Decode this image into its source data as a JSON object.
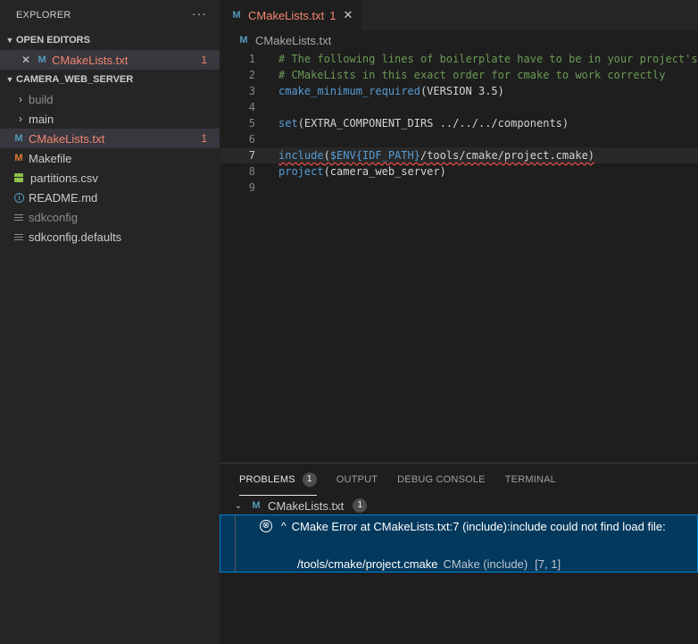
{
  "sidebar": {
    "title": "EXPLORER",
    "more": "···",
    "open_editors": {
      "label": "OPEN EDITORS",
      "items": [
        {
          "name": "CMakeLists.txt",
          "count": "1",
          "close": "✕",
          "icon_letter": "M"
        }
      ]
    },
    "project": {
      "label": "CAMERA_WEB_SERVER",
      "items": [
        {
          "name": "build",
          "kind": "folder"
        },
        {
          "name": "main",
          "kind": "folder"
        },
        {
          "name": "CMakeLists.txt",
          "kind": "file",
          "icon_letter": "M",
          "count": "1"
        },
        {
          "name": "Makefile",
          "kind": "file",
          "icon_letter": "M"
        },
        {
          "name": "partitions.csv",
          "kind": "file"
        },
        {
          "name": "README.md",
          "kind": "file",
          "icon_letter": "i"
        },
        {
          "name": "sdkconfig",
          "kind": "file"
        },
        {
          "name": "sdkconfig.defaults",
          "kind": "file"
        }
      ]
    }
  },
  "editor": {
    "tab": {
      "name": "CMakeLists.txt",
      "count": "1",
      "close": "✕",
      "icon_letter": "M"
    },
    "breadcrumb": "CMakeLists.txt",
    "lines": [
      {
        "n": "1",
        "text": "# The following lines of boilerplate have to be in your project's"
      },
      {
        "n": "2",
        "text": "# CMakeLists in this exact order for cmake to work correctly"
      },
      {
        "n": "3",
        "fn": "cmake_minimum_required",
        "args": "(VERSION 3.5)"
      },
      {
        "n": "4"
      },
      {
        "n": "5",
        "fn": "set",
        "args": "(EXTRA_COMPONENT_DIRS ../../../components)"
      },
      {
        "n": "6"
      },
      {
        "n": "7",
        "fn": "include",
        "open": "(",
        "var": "$ENV{IDF_PATH}",
        "rest": "/tools/cmake/project.cmake)"
      },
      {
        "n": "8",
        "fn": "project",
        "args": "(camera_web_server)"
      },
      {
        "n": "9"
      }
    ]
  },
  "panel": {
    "tabs": [
      "PROBLEMS",
      "OUTPUT",
      "DEBUG CONSOLE",
      "TERMINAL"
    ],
    "problems_count": "1",
    "file": {
      "name": "CMakeLists.txt",
      "count": "1",
      "icon_letter": "M"
    },
    "error": {
      "icon": "⊗",
      "caret": "^",
      "message": "CMake Error at CMakeLists.txt:7 (include):include could not find load file:",
      "detail": "/tools/cmake/project.cmake",
      "source": "CMake (include)",
      "location": "[7, 1]"
    }
  },
  "colors": {
    "error_text": "#f48771",
    "selection": "#04395e",
    "accent_border": "#007fd4"
  }
}
